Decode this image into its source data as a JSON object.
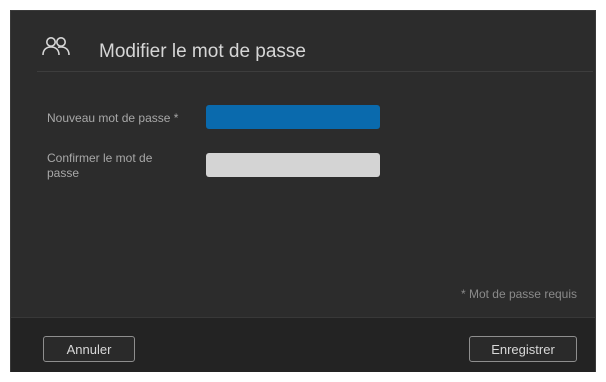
{
  "dialog": {
    "title": "Modifier le mot de passe",
    "header_icon": "users-icon"
  },
  "form": {
    "new_password_label": "Nouveau mot de passe",
    "required_marker": "*",
    "new_password_value": "",
    "confirm_password_label": "Confirmer le mot de passe",
    "confirm_password_value": ""
  },
  "required_note": "* Mot de passe requis",
  "footer": {
    "cancel_label": "Annuler",
    "save_label": "Enregistrer"
  },
  "colors": {
    "dialog_bg": "#2c2c2c",
    "footer_bg": "#232323",
    "active_input": "#0a6aad",
    "inactive_input": "#d4d4d4"
  }
}
